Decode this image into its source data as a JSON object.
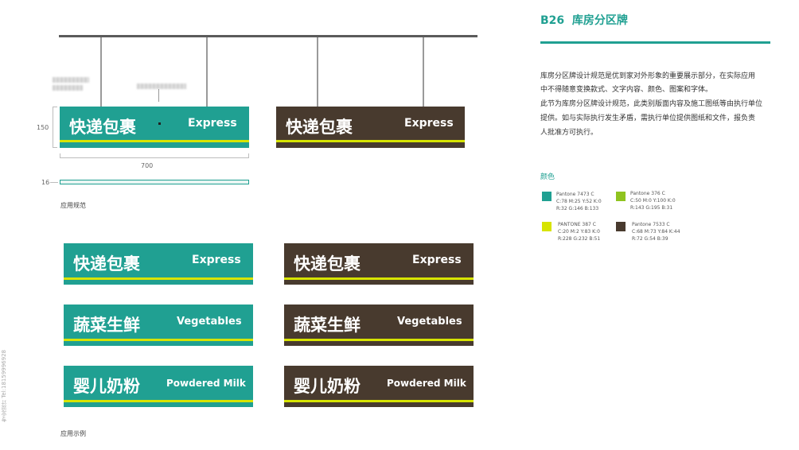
{
  "header": {
    "code": "B26",
    "title": "库房分区牌"
  },
  "description": [
    "库房分区牌设计规范是优到家对外形象的重要展示部分，在实际应用",
    "中不得随意变换款式、文字内容、颜色、图案和字体。",
    "此节为库房分区牌设计规范，此类别版面内容及施工图纸等由执行单位",
    "提供。如与实际执行发生矛盾，需执行单位提供图纸和文件，报负责",
    "人批准方可执行。"
  ],
  "colors": {
    "heading": "颜色",
    "swatches": [
      {
        "hex": "#20a092",
        "name": "Pantone 7473 C",
        "cmyk": "C:78 M:25 Y:52 K:0",
        "rgb": "R:32 G:146 B:133"
      },
      {
        "hex": "#8fc31f",
        "name": "Pantone 376 C",
        "cmyk": "C:50 M:0 Y:100 K:0",
        "rgb": "R:143 G:195 B:31"
      },
      {
        "hex": "#d7e400",
        "name": "PANTONE 387 C",
        "cmyk": "C:20 M:2 Y:83 K:0",
        "rgb": "R:228 G:232 B:51"
      },
      {
        "hex": "#483a2e",
        "name": "Pantone 7533 C",
        "cmyk": "C:68 M:73 Y:84 K:44",
        "rgb": "R:72 G:54 B:39"
      }
    ]
  },
  "spec": {
    "height_label": "150",
    "width_label": "700",
    "thickness_label": "16",
    "caption": "应用规范"
  },
  "examples_caption": "应用示例",
  "side_text": "专业设计 Tel:18159996928",
  "signs": {
    "express": {
      "cn": "快递包裹",
      "en": "Express"
    },
    "vegetables": {
      "cn": "蔬菜生鲜",
      "en": "Vegetables"
    },
    "milk": {
      "cn": "婴儿奶粉",
      "en": "Powdered Milk"
    }
  }
}
